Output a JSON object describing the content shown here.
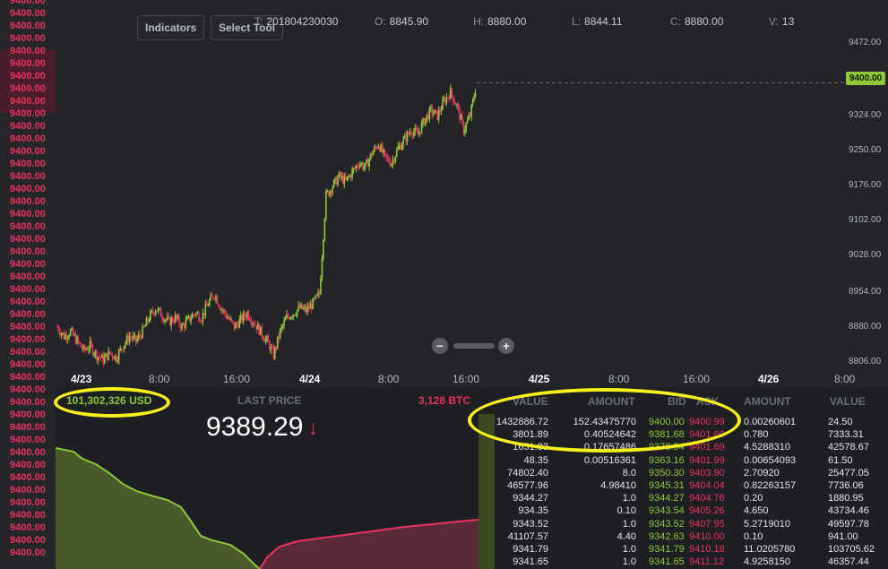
{
  "left_ladder": {
    "price": "9400.00",
    "row_count": 45
  },
  "toolbar": {
    "indicators_label": "Indicators",
    "select_tool_label": "Select Tool"
  },
  "ohlc": {
    "t_label": "T:",
    "t_value": "201804230030",
    "o_label": "O:",
    "o_value": "8845.90",
    "h_label": "H:",
    "h_value": "8880.00",
    "l_label": "L:",
    "l_value": "8844.11",
    "c_label": "C:",
    "c_value": "8880.00",
    "v_label": "V:",
    "v_value": "13"
  },
  "chart_data": {
    "type": "candlestick",
    "y_ticks": [
      "9472.00",
      "9324.00",
      "9250.00",
      "9176.00",
      "9102.00",
      "9028.00",
      "8954.00",
      "8880.00",
      "8806.00"
    ],
    "current_price_tag": "9400.00",
    "x_ticks": [
      {
        "label": "4/23",
        "bold": true
      },
      {
        "label": "8:00",
        "bold": false
      },
      {
        "label": "16:00",
        "bold": false
      },
      {
        "label": "4/24",
        "bold": true
      },
      {
        "label": "8:00",
        "bold": false
      },
      {
        "label": "16:00",
        "bold": false
      },
      {
        "label": "4/25",
        "bold": true
      },
      {
        "label": "8:00",
        "bold": false
      },
      {
        "label": "16:00",
        "bold": false
      },
      {
        "label": "4/26",
        "bold": true
      },
      {
        "label": "8:00",
        "bold": false
      }
    ],
    "ylim": [
      8790,
      9500
    ],
    "close_series": [
      8880,
      8860,
      8870,
      8850,
      8830,
      8840,
      8820,
      8810,
      8825,
      8815,
      8840,
      8860,
      8850,
      8870,
      8900,
      8920,
      8905,
      8890,
      8900,
      8880,
      8895,
      8910,
      8900,
      8930,
      8950,
      8920,
      8900,
      8880,
      8895,
      8910,
      8890,
      8870,
      8850,
      8820,
      8870,
      8900,
      8910,
      8920,
      8915,
      8930,
      8950,
      9160,
      9180,
      9200,
      9190,
      9210,
      9230,
      9220,
      9250,
      9270,
      9240,
      9230,
      9260,
      9280,
      9300,
      9290,
      9320,
      9340,
      9330,
      9360,
      9380,
      9350,
      9300,
      9330,
      9400
    ]
  },
  "depth": {
    "left_volume": "101,302,326 USD",
    "last_price_label": "LAST PRICE",
    "right_volume": "3,128 BTC",
    "last_price": "9389.29",
    "arrow": "↓"
  },
  "book": {
    "headers": [
      "VALUE",
      "AMOUNT",
      "BID",
      "ASK",
      "AMOUNT",
      "VALUE"
    ],
    "rows": [
      {
        "val": "1432886.72",
        "amt": "152.43475770",
        "bid": "9400.00",
        "ask": "9400.99",
        "amt2": "0.00260601",
        "val2": "24.50"
      },
      {
        "val": "3801.89",
        "amt": "0.40524642",
        "bid": "9381.68",
        "ask": "9401.60",
        "amt2": "0.780",
        "val2": "7333.31"
      },
      {
        "val": "1651.83",
        "amt": "0.17657486",
        "bid": "9378.54",
        "ask": "9401.69",
        "amt2": "4.5288310",
        "val2": "42578.67"
      },
      {
        "val": "48.35",
        "amt": "0.00516361",
        "bid": "9363.16",
        "ask": "9401.99",
        "amt2": "0.00654093",
        "val2": "61.50"
      },
      {
        "val": "74802.40",
        "amt": "8.0",
        "bid": "9350.30",
        "ask": "9403.90",
        "amt2": "2.70920",
        "val2": "25477.05"
      },
      {
        "val": "46577.96",
        "amt": "4.98410",
        "bid": "9345.31",
        "ask": "9404.04",
        "amt2": "0.82263157",
        "val2": "7736.06"
      },
      {
        "val": "9344.27",
        "amt": "1.0",
        "bid": "9344.27",
        "ask": "9404.76",
        "amt2": "0.20",
        "val2": "1880.95"
      },
      {
        "val": "934.35",
        "amt": "0.10",
        "bid": "9343.54",
        "ask": "9405.26",
        "amt2": "4.650",
        "val2": "43734.46"
      },
      {
        "val": "9343.52",
        "amt": "1.0",
        "bid": "9343.52",
        "ask": "9407.95",
        "amt2": "5.2719010",
        "val2": "49597.78"
      },
      {
        "val": "41107.57",
        "amt": "4.40",
        "bid": "9342.63",
        "ask": "9410.00",
        "amt2": "0.10",
        "val2": "941.00"
      },
      {
        "val": "9341.79",
        "amt": "1.0",
        "bid": "9341.79",
        "ask": "9410.18",
        "amt2": "11.0205780",
        "val2": "103705.62"
      },
      {
        "val": "9341.65",
        "amt": "1.0",
        "bid": "9341.65",
        "ask": "9411.12",
        "amt2": "4.9258150",
        "val2": "46357.44"
      }
    ]
  },
  "colors": {
    "green": "#8fc93a",
    "red": "#e8335f",
    "annotation": "#f7f01a"
  }
}
